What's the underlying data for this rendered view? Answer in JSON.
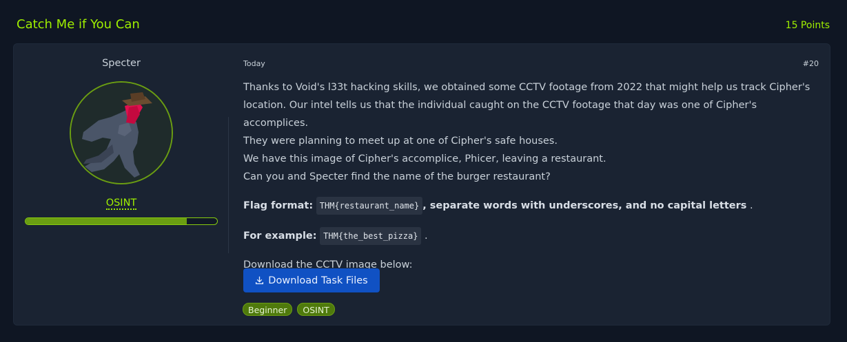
{
  "header": {
    "title": "Catch Me if You Can",
    "points": "15 Points"
  },
  "author": {
    "name": "Specter",
    "role": "OSINT",
    "progress": 0.84
  },
  "post": {
    "date": "Today",
    "number": "#20",
    "paragraph_lines": [
      "Thanks to Void's l33t hacking skills, we obtained some CCTV footage from 2022 that might help us track Cipher's",
      "location. Our intel tells us that the individual caught on the CCTV footage that day was one of Cipher's accomplices.",
      "They were planning to meet up at one of Cipher's safe houses.",
      "We have this image of Cipher's accomplice, Phicer, leaving a restaurant.",
      "Can you and Specter find the name of the burger restaurant?"
    ],
    "flag_format": {
      "label": "Flag format:",
      "code": "THM{restaurant_name}",
      "suffix": ", separate words with underscores, and no capital letters",
      "end": " ."
    },
    "example": {
      "label": "For example:",
      "code": "THM{the_best_pizza}",
      "end": " ."
    },
    "download_intro": "Download the CCTV image below:",
    "download_button": "Download Task Files",
    "tags": [
      "Beginner",
      "OSINT"
    ]
  },
  "colors": {
    "accent": "#9fef00",
    "card": "#1a2332",
    "button": "#1051c3",
    "tag": "#4f7a0c"
  }
}
